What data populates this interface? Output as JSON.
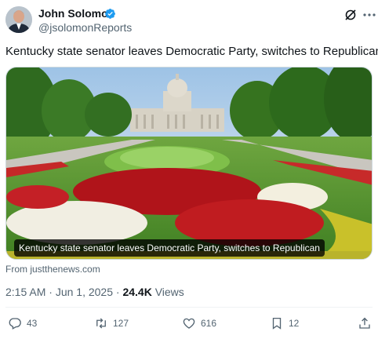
{
  "author": {
    "name": "John Solomon",
    "handle": "@jsolomonReports",
    "verified_color": "#1d9bf0"
  },
  "tweet": {
    "text": "Kentucky state senator leaves Democratic Party, switches to Republican"
  },
  "media": {
    "caption": "Kentucky state senator leaves Democratic Party, switches to Republican",
    "source": "From justthenews.com"
  },
  "meta": {
    "time": "2:15 AM",
    "separator": " · ",
    "date": "Jun 1, 2025",
    "views_count": "24.4K",
    "views_label": " Views"
  },
  "actions": {
    "replies": "43",
    "reposts": "127",
    "likes": "616",
    "bookmarks": "12"
  },
  "icons": {
    "grok": "grok-icon",
    "more": "more-icon",
    "reply": "reply-icon",
    "repost": "repost-icon",
    "like": "like-icon",
    "bookmark": "bookmark-icon",
    "share": "share-icon"
  }
}
